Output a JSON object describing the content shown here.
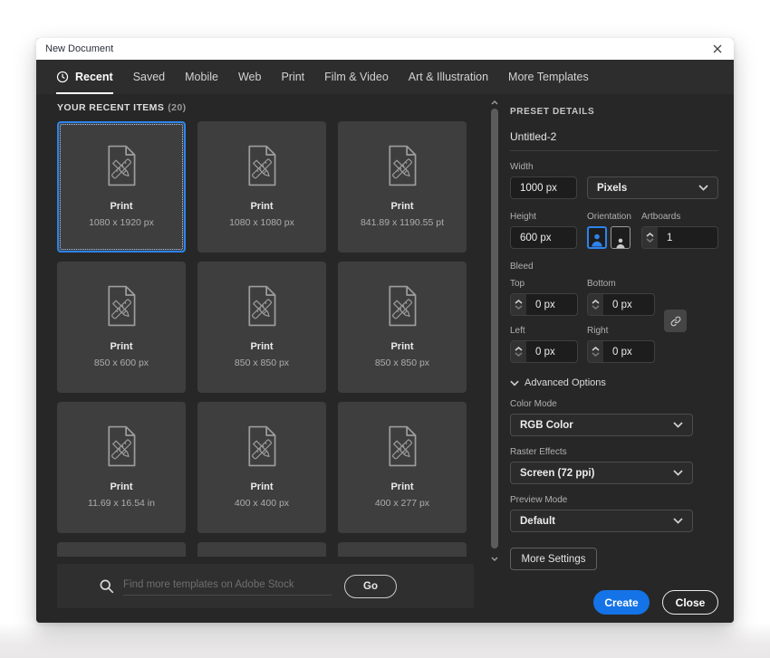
{
  "window": {
    "title": "New Document"
  },
  "tabs": {
    "items": [
      {
        "label": "Recent",
        "active": true,
        "icon": "clock"
      },
      {
        "label": "Saved"
      },
      {
        "label": "Mobile"
      },
      {
        "label": "Web"
      },
      {
        "label": "Print"
      },
      {
        "label": "Film & Video"
      },
      {
        "label": "Art & Illustration"
      },
      {
        "label": "More Templates"
      }
    ]
  },
  "recent": {
    "heading": "YOUR RECENT ITEMS",
    "count": "(20)",
    "items": [
      {
        "name": "Print",
        "dims": "1080 x 1920 px",
        "selected": true
      },
      {
        "name": "Print",
        "dims": "1080 x 1080 px",
        "selected": false
      },
      {
        "name": "Print",
        "dims": "841.89 x 1190.55 pt",
        "selected": false
      },
      {
        "name": "Print",
        "dims": "850 x 600 px",
        "selected": false
      },
      {
        "name": "Print",
        "dims": "850 x 850 px",
        "selected": false
      },
      {
        "name": "Print",
        "dims": "850 x 850 px",
        "selected": false
      },
      {
        "name": "Print",
        "dims": "11.69 x 16.54 in",
        "selected": false
      },
      {
        "name": "Print",
        "dims": "400 x 400 px",
        "selected": false
      },
      {
        "name": "Print",
        "dims": "400 x 277 px",
        "selected": false
      }
    ]
  },
  "search": {
    "placeholder": "Find more templates on Adobe Stock",
    "go": "Go"
  },
  "preset": {
    "heading": "PRESET DETAILS",
    "name": "Untitled-2",
    "width_label": "Width",
    "width_value": "1000 px",
    "units": "Pixels",
    "height_label": "Height",
    "height_value": "600 px",
    "orientation_label": "Orientation",
    "artboards_label": "Artboards",
    "artboards_value": "1",
    "bleed_label": "Bleed",
    "bleed": {
      "top_label": "Top",
      "top": "0 px",
      "bottom_label": "Bottom",
      "bottom": "0 px",
      "left_label": "Left",
      "left": "0 px",
      "right_label": "Right",
      "right": "0 px"
    },
    "advanced_label": "Advanced Options",
    "color_mode_label": "Color Mode",
    "color_mode": "RGB Color",
    "raster_label": "Raster Effects",
    "raster": "Screen (72 ppi)",
    "preview_label": "Preview Mode",
    "preview": "Default",
    "more_settings": "More Settings",
    "create": "Create",
    "close": "Close"
  },
  "icons": [
    "clock-icon",
    "close-icon",
    "document-template-icon",
    "search-icon",
    "chevron-down-icon",
    "chevron-up-icon",
    "portrait-orientation-icon",
    "landscape-orientation-icon",
    "link-icon",
    "scrollbar-up-icon",
    "scrollbar-down-icon"
  ],
  "colors": {
    "accent": "#1473e6",
    "selection_border": "#2e83ec"
  }
}
